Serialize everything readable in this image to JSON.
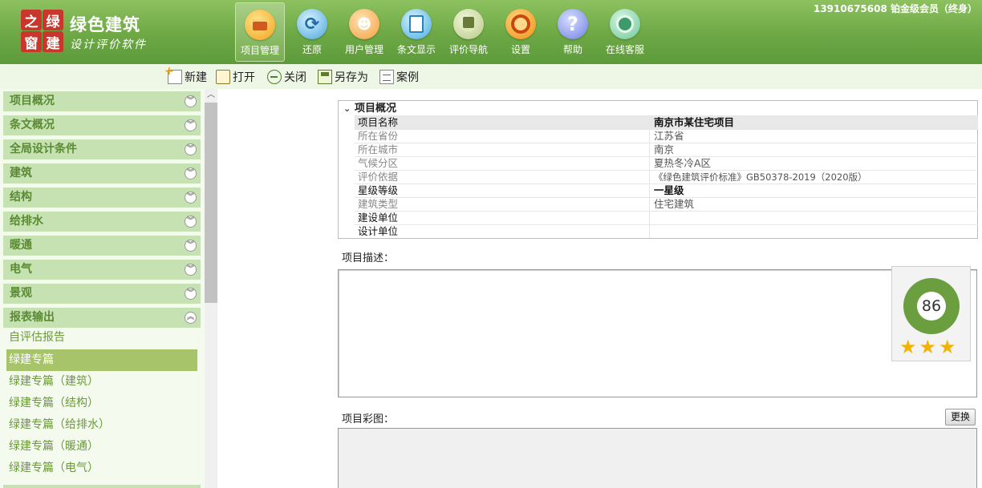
{
  "header": {
    "logo_chars": [
      "之",
      "绿",
      "窗",
      "建"
    ],
    "brand_title": "绿色建筑",
    "brand_sub": "设计评价软件",
    "user_info": "13910675608 铂金级会员（终身）",
    "toolbar": [
      {
        "label": "项目管理",
        "icon": "project-icon"
      },
      {
        "label": "还原",
        "icon": "restore-icon"
      },
      {
        "label": "用户管理",
        "icon": "user-icon"
      },
      {
        "label": "条文显示",
        "icon": "article-icon"
      },
      {
        "label": "评价导航",
        "icon": "guide-icon"
      },
      {
        "label": "设置",
        "icon": "settings-icon"
      },
      {
        "label": "帮助",
        "icon": "help-icon"
      },
      {
        "label": "在线客服",
        "icon": "service-icon"
      }
    ]
  },
  "file_bar": {
    "new": "新建",
    "open": "打开",
    "close": "关闭",
    "save_as": "另存为",
    "case": "案例"
  },
  "sidebar": {
    "sections": [
      "项目概况",
      "条文概况",
      "全局设计条件",
      "建筑",
      "结构",
      "给排水",
      "暖通",
      "电气",
      "景观",
      "报表输出"
    ],
    "report_items": [
      "自评估报告",
      "绿建专篇",
      "绿建专篇（建筑）",
      "绿建专篇（结构）",
      "绿建专篇（给排水）",
      "绿建专篇（暖通）",
      "绿建专篇（电气）"
    ],
    "selected": "绿建专篇"
  },
  "project": {
    "panel_title": "项目概况",
    "rows": [
      {
        "label": "项目名称",
        "value": "南京市某住宅项目"
      },
      {
        "label": "所在省份",
        "value": "江苏省"
      },
      {
        "label": "所在城市",
        "value": "南京"
      },
      {
        "label": "气候分区",
        "value": "夏热冬冷A区"
      },
      {
        "label": "评价依据",
        "value": "《绿色建筑评价标准》GB50378-2019（2020版）"
      },
      {
        "label": "星级等级",
        "value": "一星级"
      },
      {
        "label": "建筑类型",
        "value": "住宅建筑"
      },
      {
        "label": "建设单位",
        "value": ""
      },
      {
        "label": "设计单位",
        "value": ""
      }
    ]
  },
  "description_label": "项目描述：",
  "score": {
    "value": "86",
    "stars": "★★★"
  },
  "image_label": "项目彩图：",
  "replace_button": "更换"
}
